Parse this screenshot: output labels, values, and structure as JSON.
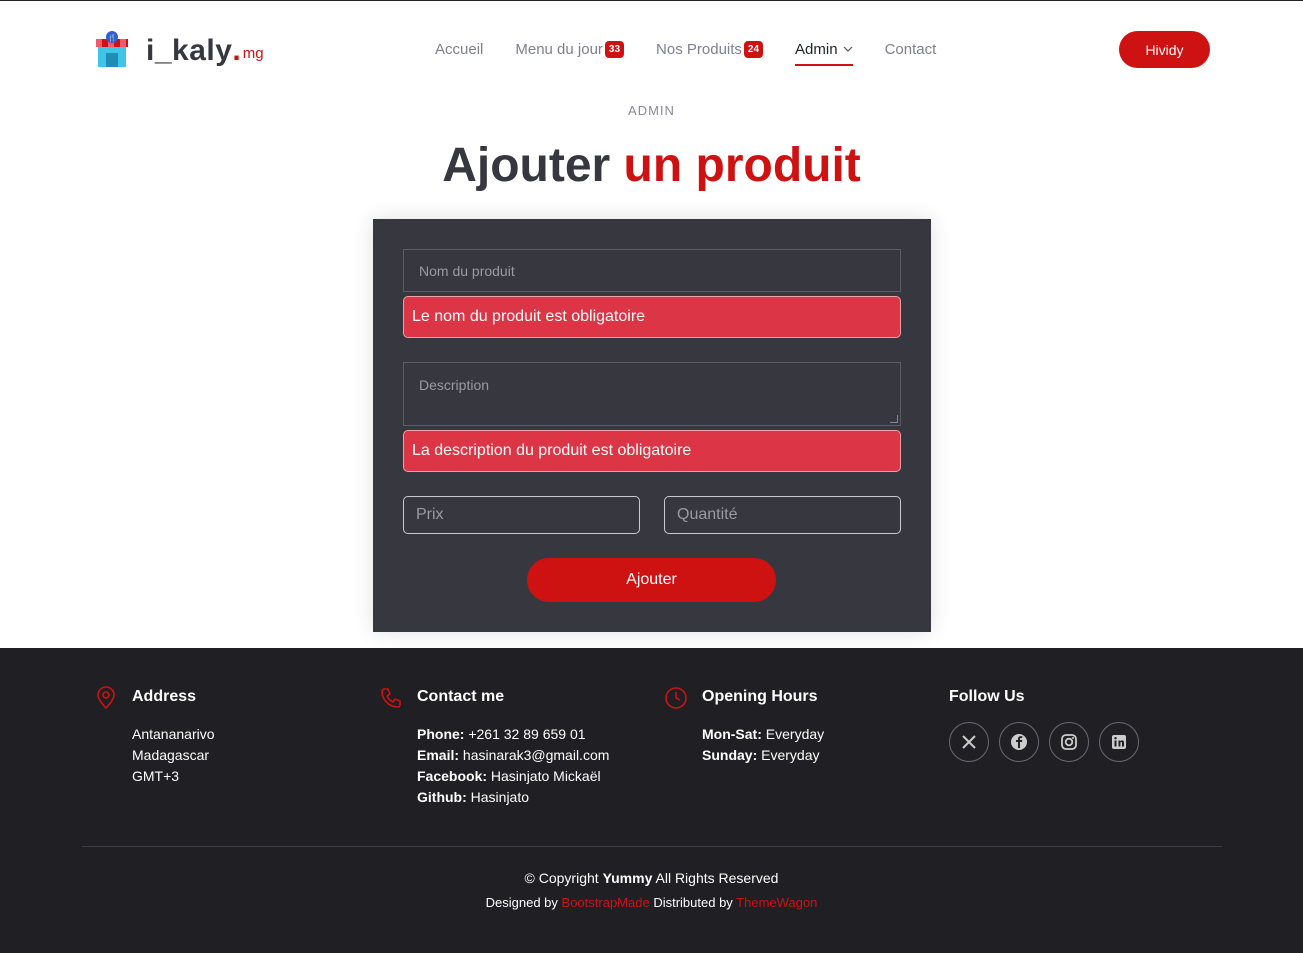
{
  "brand": {
    "name": "i_kaly",
    "dot": ".",
    "suffix": "mg"
  },
  "nav": {
    "items": [
      {
        "label": "Accueil"
      },
      {
        "label": "Menu du jour",
        "badge": "33"
      },
      {
        "label": "Nos Produits",
        "badge": "24"
      },
      {
        "label": "Admin",
        "active": true
      },
      {
        "label": "Contact"
      }
    ],
    "cta": "Hividy"
  },
  "section": {
    "label": "ADMIN",
    "title_main": "Ajouter",
    "title_accent": "un produit"
  },
  "form": {
    "name_placeholder": "Nom du produit",
    "name_error": "Le nom du produit est obligatoire",
    "desc_placeholder": "Description",
    "desc_error": "La description du produit est obligatoire",
    "price_placeholder": "Prix",
    "qty_placeholder": "Quantité",
    "submit_label": "Ajouter"
  },
  "footer": {
    "address": {
      "title": "Address",
      "lines": [
        "Antananarivo",
        "Madagascar",
        "GMT+3"
      ]
    },
    "contact": {
      "title": "Contact me",
      "rows": [
        {
          "k": "Phone:",
          "v": " +261 32 89 659 01"
        },
        {
          "k": "Email:",
          "v": " hasinarak3@gmail.com"
        },
        {
          "k": "Facebook:",
          "v": " Hasinjato Mickaël"
        },
        {
          "k": "Github:",
          "v": " Hasinjato"
        }
      ]
    },
    "hours": {
      "title": "Opening Hours",
      "rows": [
        {
          "k": "Mon-Sat:",
          "v": " Everyday"
        },
        {
          "k": "Sunday:",
          "v": " Everyday"
        }
      ]
    },
    "follow": {
      "title": "Follow Us",
      "icons": [
        "x-icon",
        "facebook-icon",
        "instagram-icon",
        "linkedin-icon"
      ]
    },
    "copyright_pre": "© Copyright ",
    "copyright_brand": "Yummy",
    "copyright_post": " All Rights Reserved",
    "designed_pre": "Designed by ",
    "designed_by": "BootstrapMade",
    "distributed_pre": " Distributed by ",
    "distributed_by": "ThemeWagon"
  },
  "colors": {
    "accent": "#ce1212",
    "dark": "#37373f",
    "footer_bg": "#1f1f24",
    "alert": "#dc3545"
  }
}
